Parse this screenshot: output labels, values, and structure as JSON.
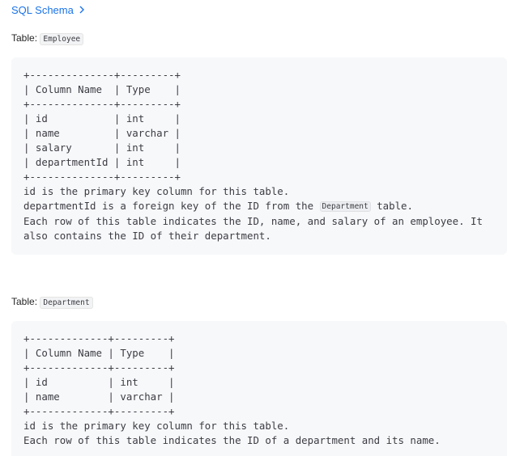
{
  "header": {
    "schema_link": "SQL Schema",
    "chevron_icon": "chevron-right-icon"
  },
  "employee": {
    "label_prefix": "Table:",
    "table_name": "Employee",
    "ascii": [
      "+--------------+---------+",
      "| Column Name  | Type    |",
      "+--------------+---------+",
      "| id           | int     |",
      "| name         | varchar |",
      "| salary       | int     |",
      "| departmentId | int     |",
      "+--------------+---------+"
    ],
    "note1": "id is the primary key column for this table.",
    "note2_before": "departmentId is a foreign key of the ID from the ",
    "note2_code": "Department",
    "note2_after": " table.",
    "note3": "Each row of this table indicates the ID, name, and salary of an employee. It\nalso contains the ID of their department."
  },
  "department": {
    "label_prefix": "Table:",
    "table_name": "Department",
    "ascii": [
      "+-------------+---------+",
      "| Column Name | Type    |",
      "+-------------+---------+",
      "| id          | int     |",
      "| name        | varchar |",
      "+-------------+---------+"
    ],
    "note1": "id is the primary key column for this table.",
    "note2": "Each row of this table indicates the ID of a department and its name."
  }
}
